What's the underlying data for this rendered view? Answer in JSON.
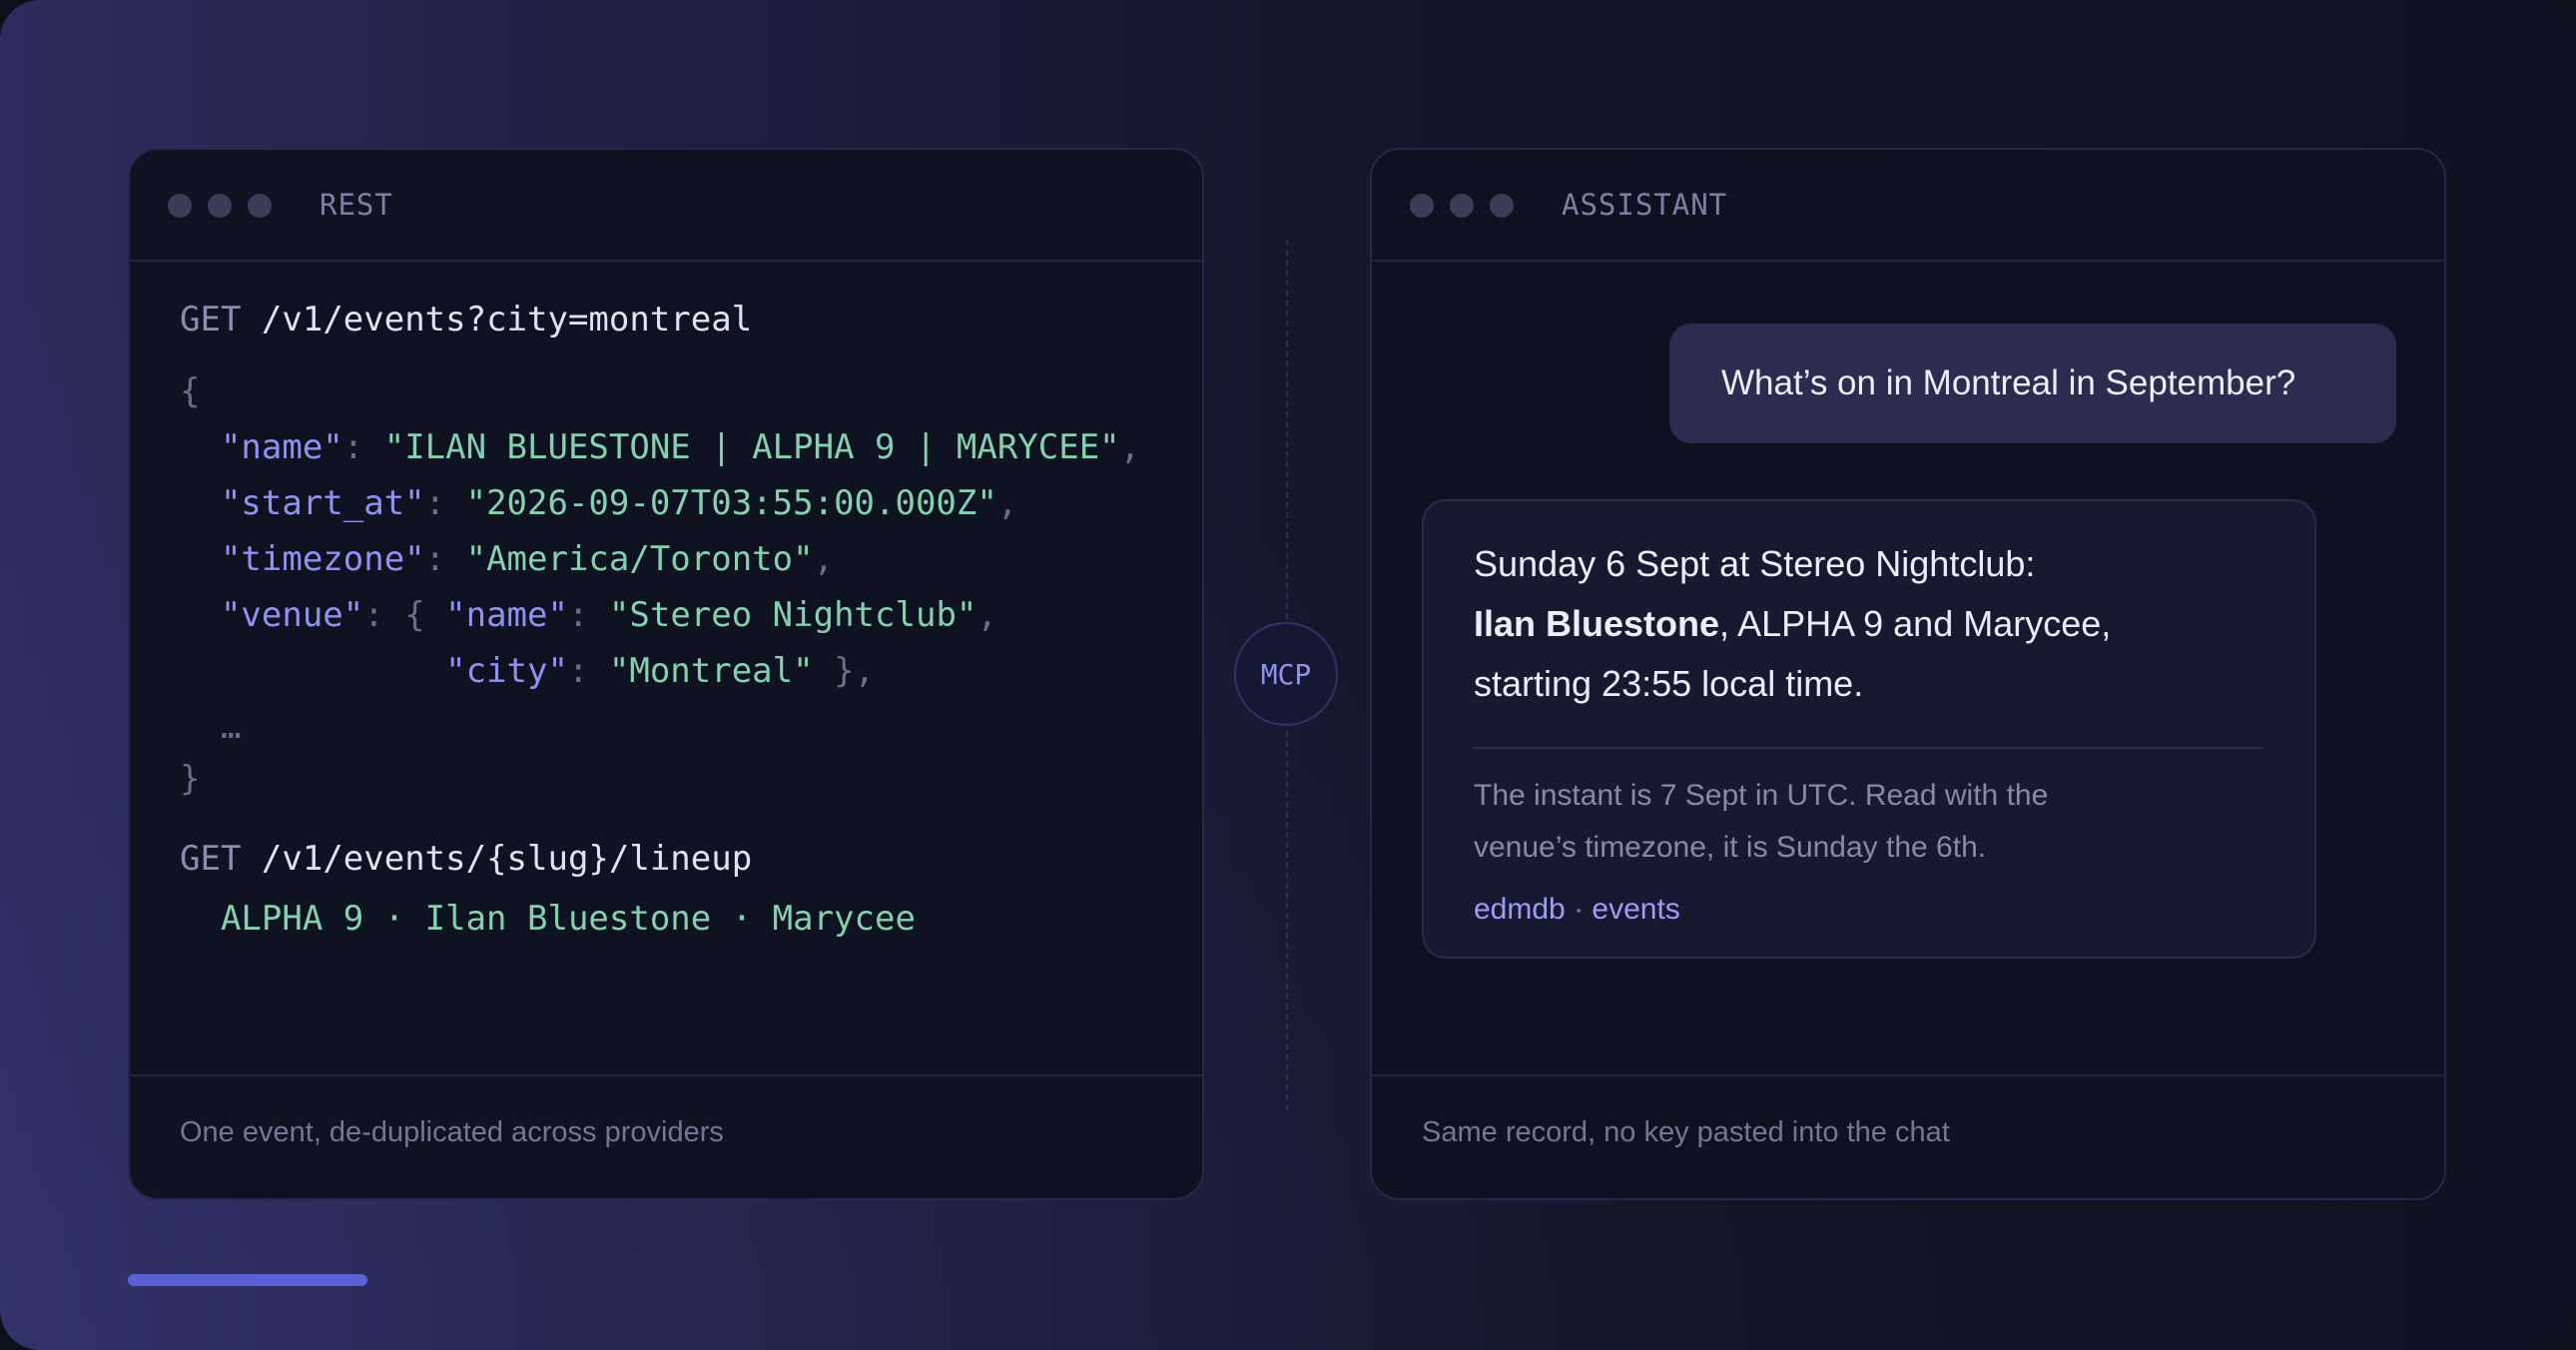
{
  "rest_panel": {
    "title": "REST",
    "code": {
      "req1_method": "GET",
      "req1_path": "/v1/events?city=montreal",
      "open_brace": "{",
      "name_key": "\"name\"",
      "name_value": "\"ILAN BLUESTONE | ALPHA 9 | MARYCEE\"",
      "start_key": "\"start_at\"",
      "start_value": "\"2026-09-07T03:55:00.000Z\"",
      "tz_key": "\"timezone\"",
      "tz_value": "\"America/Toronto\"",
      "venue_key": "\"venue\"",
      "venue_name_key": "\"name\"",
      "venue_name_value": "\"Stereo Nightclub\"",
      "city_key": "\"city\"",
      "city_value": "\"Montreal\"",
      "ellipsis": "…",
      "close_brace": "}",
      "req2_method": "GET",
      "req2_path": "/v1/events/{slug}/lineup",
      "lineup": "ALPHA 9 · Ilan Bluestone · Marycee"
    },
    "footer": "One event, de-duplicated across providers"
  },
  "connector": {
    "label": "MCP"
  },
  "assistant_panel": {
    "title": "ASSISTANT",
    "user_message": "What’s on in Montreal in September?",
    "reply": {
      "line1": "Sunday 6 Sept at Stereo Nightclub:",
      "line2_bold": "Ilan Bluestone",
      "line2_rest": ", ALPHA 9 and Marycee,",
      "line3": "starting 23:55 local time.",
      "note_line1": "The instant is 7 Sept in UTC. Read with the",
      "note_line2": "venue’s timezone, it is Sunday the 6th.",
      "source_a": "edmdb",
      "source_sep": "·",
      "source_b": "events"
    },
    "footer": "Same record, no key pasted into the chat"
  },
  "colors": {
    "accent": "#5b62d3",
    "json_key": "#8e93f0",
    "json_string": "#86cfaf"
  }
}
